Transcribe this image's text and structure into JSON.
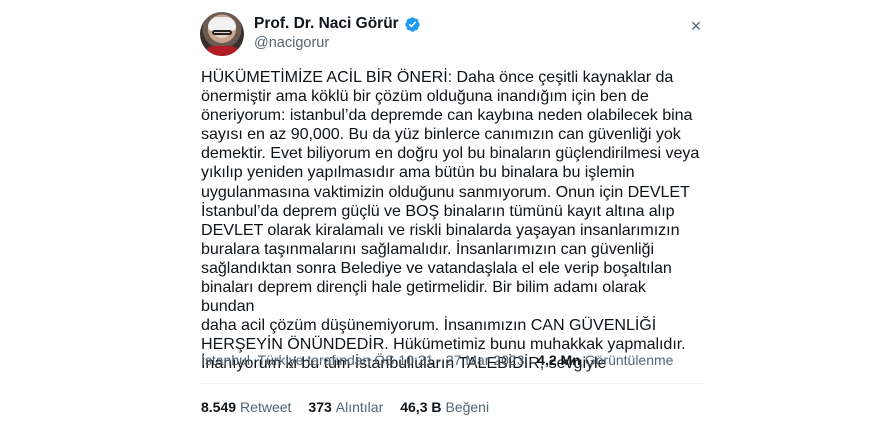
{
  "author": {
    "name": "Prof. Dr. Naci Görür",
    "handle": "@nacigorur",
    "verified_color": "#1d9bf0"
  },
  "close_icon": "×",
  "tweet_text": "HÜKÜMETİMİZE ACİL BİR ÖNERİ: Daha önce çeşitli kaynaklar da\nönermiştir ama köklü bir çözüm olduğuna inandığım için ben de\nöneriyorum: istanbul’da depremde can kaybına neden olabilecek bina\nsayısı en az 90,000. Bu da yüz binlerce canımızın can güvenliği yok\ndemektir. Evet biliyorum en doğru yol bu binaların güçlendirilmesi veya\nyıkılıp yeniden yapılmasıdır ama bütün bu binalara bu işlemin\nuygulanmasına vaktimizin olduğunu sanmıyorum. Onun için DEVLET\nİstanbul’da deprem güçlü ve BOŞ binaların tümünü kayıt altına alıp\nDEVLET olarak kiralamalı ve riskli binalarda yaşayan insanlarımızın\nburalara taşınmalarını sağlamalıdır. İnsanlarımızın can güvenliği\nsağlandıktan sonra Belediye ve vatandaşlala el ele verip boşaltılan\nbinaları deprem dirençli hale getirmelidir. Bir bilim adamı olarak bundan\ndaha acil çözüm düşünemiyorum. İnsanımızın CAN GÜVENLİĞİ\nHERŞEYİN ÖNÜNDEDİR. Hükümetimiz bunu muhakkak yapmalıdır.\nİnanıyorum ki bu tüm İstanbulluların TALEBİDİR, sevgiyle",
  "meta": {
    "location_time": "İstanbul, Türkiye tarafından ÖS 10:21 · 27 Mar 2023",
    "separator": "·",
    "views_count": "4,2 Mn",
    "views_label": "Görüntülenme"
  },
  "stats": {
    "retweets_count": "8.549",
    "retweets_label": "Retweet",
    "quotes_count": "373",
    "quotes_label": "Alıntılar",
    "likes_count": "46,3 B",
    "likes_label": "Beğeni"
  }
}
